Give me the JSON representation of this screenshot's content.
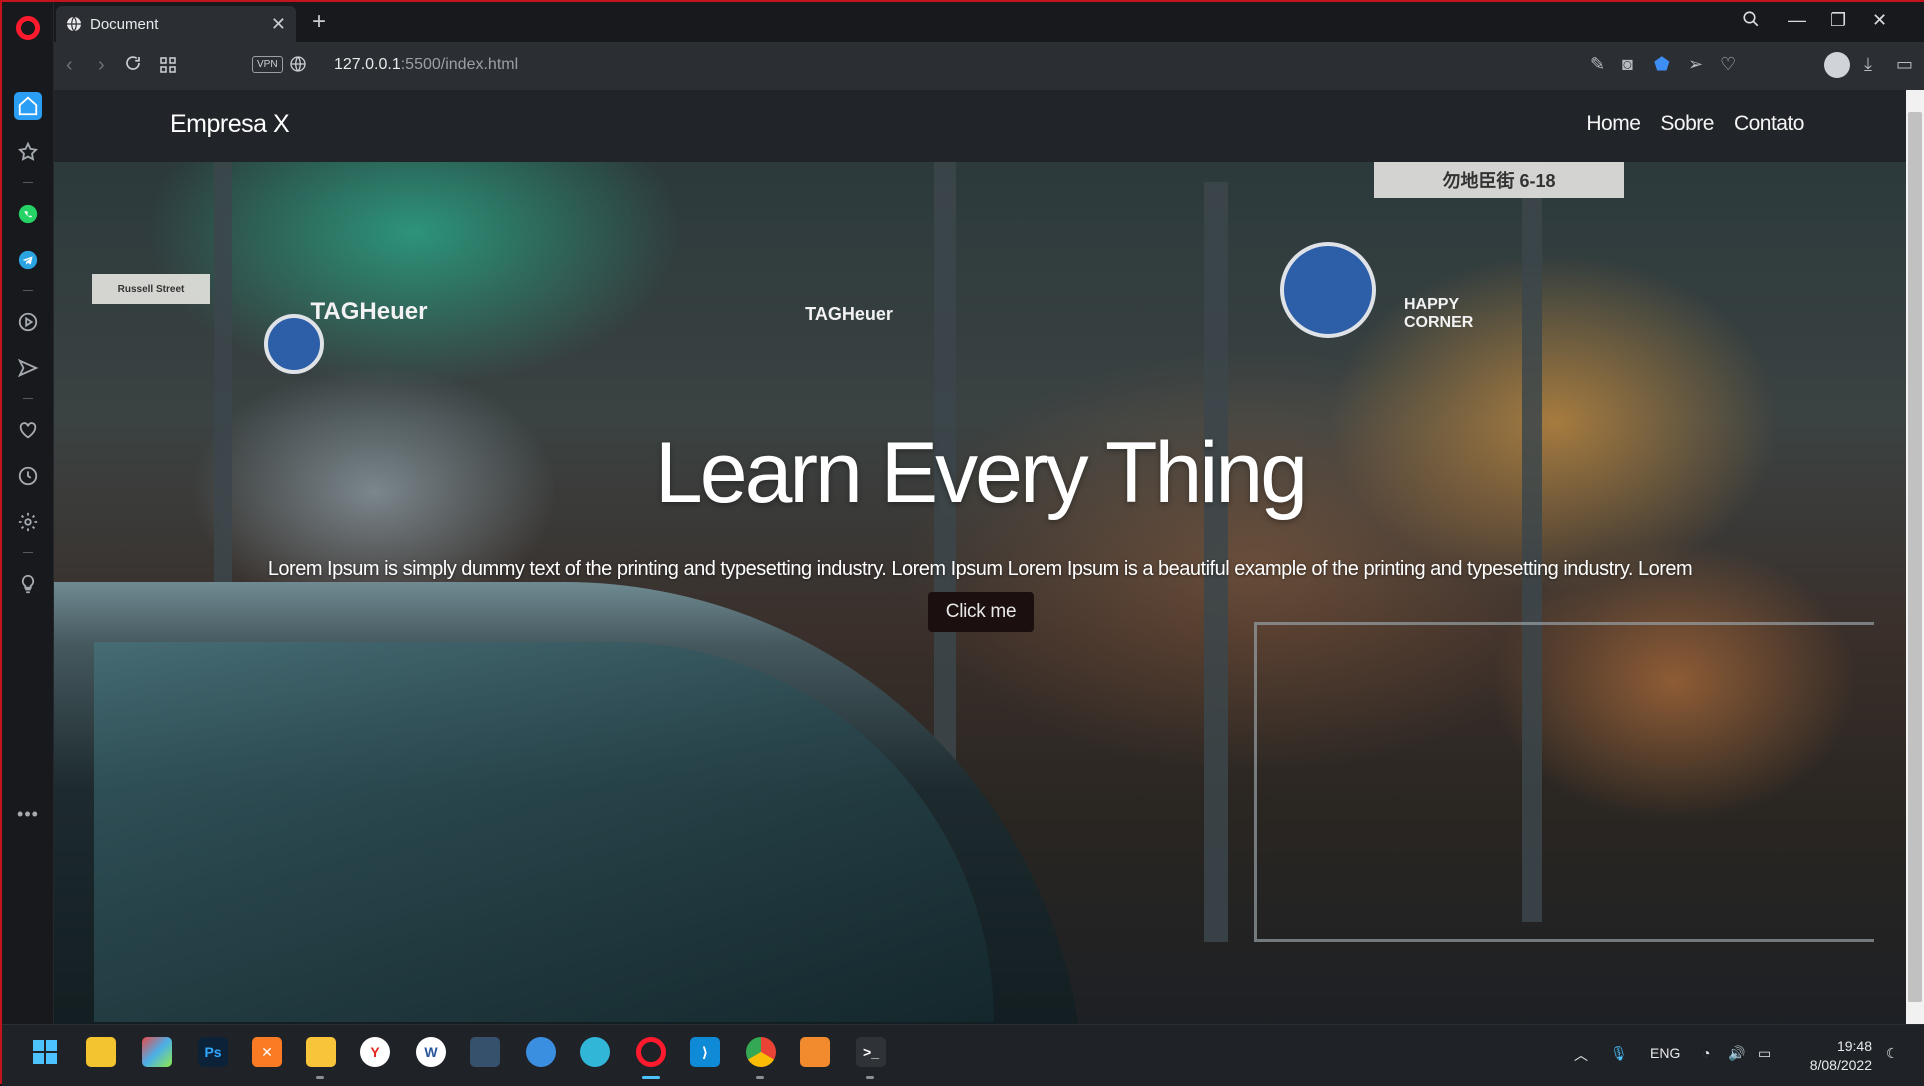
{
  "browser": {
    "tab_title": "Document",
    "url_host": "127.0.0.1",
    "url_rest": ":5500/index.html",
    "vpn_label": "VPN"
  },
  "site": {
    "brand": "Empresa X",
    "nav_links": [
      "Home",
      "Sobre",
      "Contato"
    ],
    "hero_title": "Learn Every Thing",
    "hero_text": "Lorem Ipsum is simply dummy text of the printing and typesetting industry. Lorem Ipsum Lorem Ipsum is a beautiful example of the printing and typesetting industry. Lorem",
    "hero_button": "Click me",
    "street_sign": "勿地臣街 6-18",
    "shop_signs": [
      "TAGHeuer",
      "TAGHeuer",
      "HAPPY CORNER"
    ],
    "street_name": "Russell Street"
  },
  "taskbar": {
    "language": "ENG",
    "time": "19:48",
    "date": "8/08/2022",
    "apps": [
      "start-icon",
      "files-icon",
      "paint-icon",
      "photoshop-icon",
      "xampp-icon",
      "explorer-icon",
      "yandex-icon",
      "word-icon",
      "mysql-icon",
      "cloud-icon",
      "globe-icon",
      "opera-icon",
      "vscode-icon",
      "chrome-icon",
      "sublime-icon",
      "terminal-icon"
    ]
  },
  "colors": {
    "frame_border": "#c4141b",
    "opera_red": "#ff1b2d",
    "navbar_bg": "#212529",
    "button_bg": "#1b0f0f",
    "accent_blue": "#2a9df4"
  }
}
